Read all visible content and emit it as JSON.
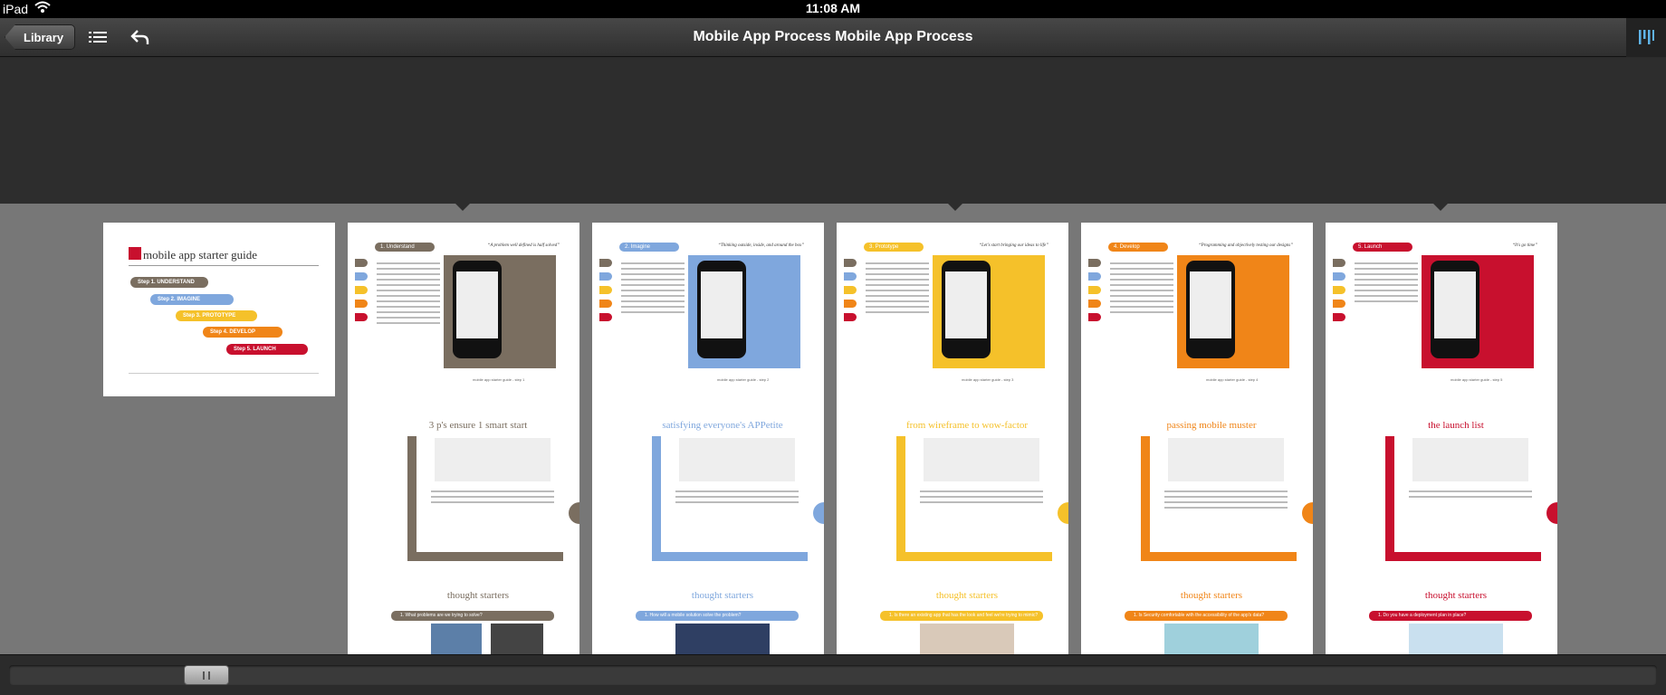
{
  "status_bar": {
    "device": "iPad",
    "time": "11:08 AM"
  },
  "toolbar": {
    "library_label": "Library",
    "title": "Mobile App Process Mobile App Process"
  },
  "cover": {
    "title": "mobile app starter guide",
    "steps": [
      {
        "label": "Step 1.  UNDERSTAND",
        "color": "#7a6e60"
      },
      {
        "label": "Step 2.  IMAGINE",
        "color": "#7fa7dd"
      },
      {
        "label": "Step 3.  PROTOTYPE",
        "color": "#f5c12a"
      },
      {
        "label": "Step 4.  DEVELOP",
        "color": "#f08518"
      },
      {
        "label": "Step 5.  LAUNCH",
        "color": "#c8102e"
      }
    ]
  },
  "pages": [
    {
      "section": "1. Understand",
      "quote": "“A problem well defined is half solved”",
      "title": "3 p's ensure 1 smart start",
      "starters": "thought starters",
      "question": "1. What problems are we trying to solve?",
      "footer": "mobile app starter guide - step 1",
      "color": "#7a6e60"
    },
    {
      "section": "2. Imagine",
      "quote": "“Thinking outside, inside, and around the box”",
      "title": "satisfying everyone's APPetite",
      "starters": "thought starters",
      "question": "1. How will a mobile solution solve the problem?",
      "footer": "mobile app starter guide - step 2",
      "color": "#7fa7dd"
    },
    {
      "section": "3. Prototype",
      "quote": "“Let's start bringing our ideas to life”",
      "title": "from wireframe to wow-factor",
      "starters": "thought starters",
      "question": "1. Is there an existing app that has the look and feel we're trying to mimic?",
      "footer": "mobile app starter guide - step 3",
      "color": "#f5c12a"
    },
    {
      "section": "4. Develop",
      "quote": "“Programming and objectively testing our designs”",
      "title": "passing mobile muster",
      "starters": "thought starters",
      "question": "1. Is Security comfortable with the accessibility of the app's data?",
      "footer": "mobile app starter guide - step 4",
      "color": "#f08518"
    },
    {
      "section": "5. Launch",
      "quote": "“It's go time”",
      "title": "the launch list",
      "starters": "thought starters",
      "question": "1. Do you have a deployment plan in place?",
      "footer": "mobile app starter guide - step 5",
      "color": "#c8102e"
    }
  ]
}
